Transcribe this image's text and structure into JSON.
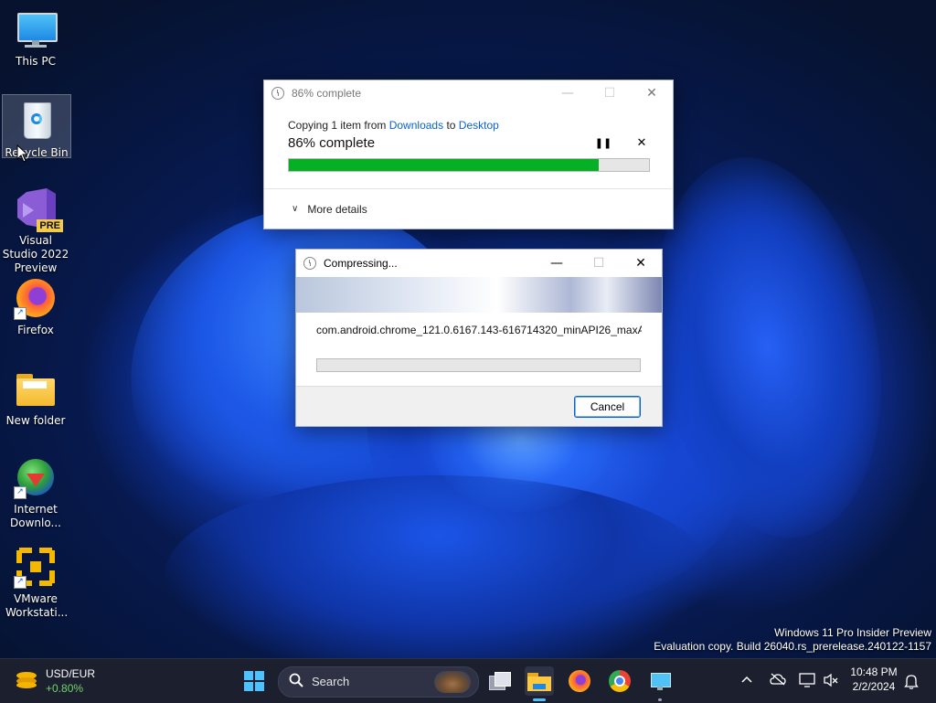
{
  "desktop": {
    "icons": [
      {
        "label": "This PC"
      },
      {
        "label": "Recycle Bin"
      },
      {
        "label": "Visual Studio 2022 Preview",
        "badge": "PRE"
      },
      {
        "label": "Firefox"
      },
      {
        "label": "New folder"
      },
      {
        "label": "Internet Downlo..."
      },
      {
        "label": "VMware Workstati..."
      }
    ],
    "watermark": {
      "line1": "Windows 11 Pro Insider Preview",
      "line2": "Evaluation copy. Build 26040.rs_prerelease.240122-1157"
    }
  },
  "copy_dialog": {
    "title": "86% complete",
    "copying_prefix": "Copying 1 item from",
    "source": "Downloads",
    "to_word": "to",
    "destination": "Desktop",
    "status": "86% complete",
    "progress": 0.86,
    "more_details": "More details",
    "progress_color": "#06b025"
  },
  "compress_dialog": {
    "title": "Compressing...",
    "filename": "com.android.chrome_121.0.6167.143-616714320_minAPI26_maxAPI2",
    "progress": 0,
    "cancel_label": "Cancel"
  },
  "taskbar": {
    "widget_title": "USD/EUR",
    "widget_value": "+0.80%",
    "search_placeholder": "Search",
    "time": "10:48 PM",
    "date": "2/2/2024",
    "apps": [
      "start-icon",
      "search",
      "task-view-icon",
      "file-explorer-icon",
      "firefox-icon",
      "chrome-icon",
      "remote-desktop-icon"
    ]
  }
}
